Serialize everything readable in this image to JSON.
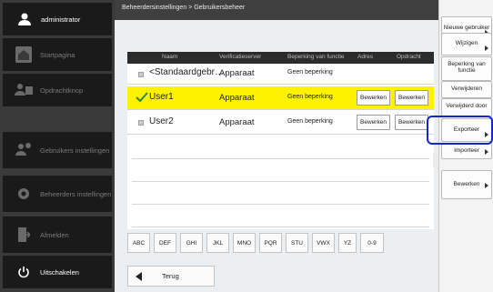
{
  "user": {
    "name": "administrator"
  },
  "sidebar": {
    "items": [
      {
        "label": "Startpagina",
        "icon": "home-icon"
      },
      {
        "label": "Opdrachtknop",
        "icon": "users-icon"
      },
      {
        "label": "Gebruikers instellingen",
        "icon": "gear-user-icon"
      },
      {
        "label": "Beheerders instellingen",
        "icon": "gear-icon"
      },
      {
        "label": "Afmelden",
        "icon": "logout-icon"
      }
    ],
    "power": {
      "label": "Uitschakelen",
      "icon": "power-icon"
    }
  },
  "breadcrumb": "Beheerdersinstellingen > Gebruikersbeheer",
  "list": {
    "headers": [
      "Naam",
      "Verificatieserver",
      "Beperking van functie",
      "Adres",
      "Opdracht"
    ],
    "rows": [
      {
        "name": "<Standaardgebr…",
        "server": "Apparaat",
        "restriction": "Geen beperking",
        "adres": "",
        "opdracht": "",
        "selected": false
      },
      {
        "name": "User1",
        "server": "Apparaat",
        "restriction": "Geen beperking",
        "adres": "Bewerken",
        "opdracht": "Bewerken",
        "selected": true
      },
      {
        "name": "User2",
        "server": "Apparaat",
        "restriction": "Geen beperking",
        "adres": "Bewerken",
        "opdracht": "Bewerken",
        "selected": false
      }
    ]
  },
  "alpha": [
    "ABC",
    "DEF",
    "GHI",
    "JKL",
    "MNO",
    "PQR",
    "STU",
    "VWX",
    "YZ",
    "0-9"
  ],
  "back": "Terug",
  "right": {
    "new_user": "Nieuwe gebruiker",
    "change": "Wijzigen",
    "restrict": "Beperking van functie",
    "delete": "Verwijderen",
    "deleted_by": "Verwijderd door",
    "export": "Exporteer",
    "import": "Importeer",
    "edit": "Bewerken"
  }
}
